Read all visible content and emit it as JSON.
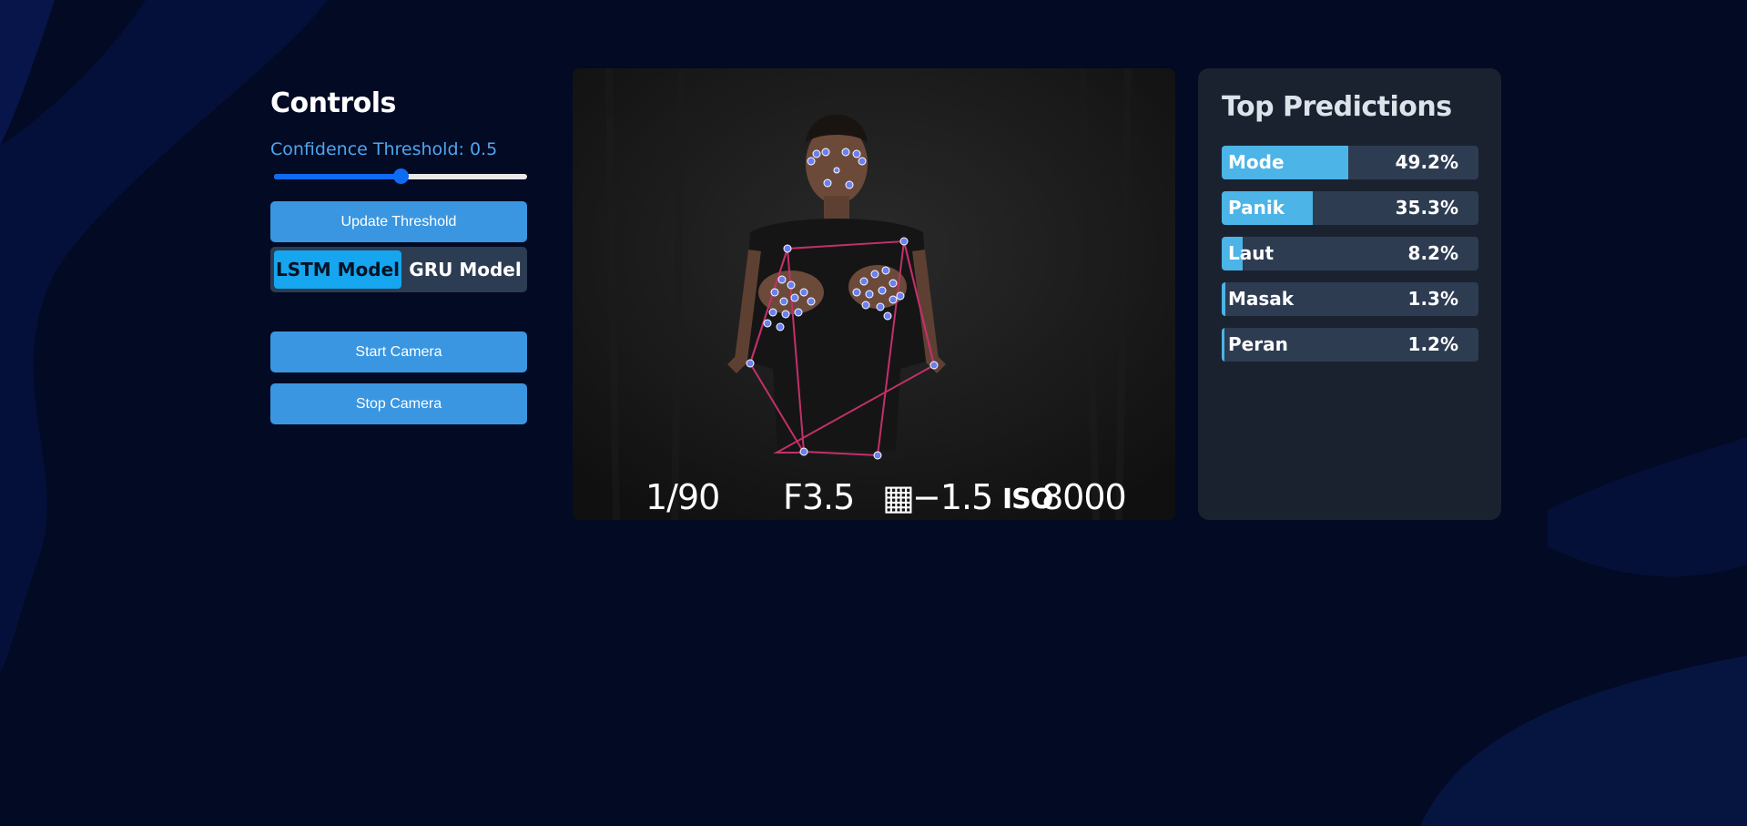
{
  "controls": {
    "title": "Controls",
    "threshold_label": "Confidence Threshold: 0.5",
    "threshold_value": 0.5,
    "update_button": "Update Threshold",
    "models": [
      {
        "label": "LSTM Model",
        "active": true
      },
      {
        "label": "GRU Model",
        "active": false
      }
    ],
    "start_button": "Start Camera",
    "stop_button": "Stop Camera"
  },
  "video": {
    "shutter": "1/90",
    "aperture": "F3.5",
    "exposure": "−1.5",
    "iso_label": "ISO",
    "iso_value": "8000"
  },
  "predictions": {
    "title": "Top Predictions",
    "items": [
      {
        "label": "Mode",
        "percent_text": "49.2%",
        "value": 0.492
      },
      {
        "label": "Panik",
        "percent_text": "35.3%",
        "value": 0.353
      },
      {
        "label": "Laut",
        "percent_text": "8.2%",
        "value": 0.082
      },
      {
        "label": "Masak",
        "percent_text": "1.3%",
        "value": 0.013
      },
      {
        "label": "Peran",
        "percent_text": "1.2%",
        "value": 0.012
      }
    ]
  },
  "colors": {
    "accent": "#3a96e0",
    "bar": "#4cb4e7",
    "background": "#020a24"
  }
}
